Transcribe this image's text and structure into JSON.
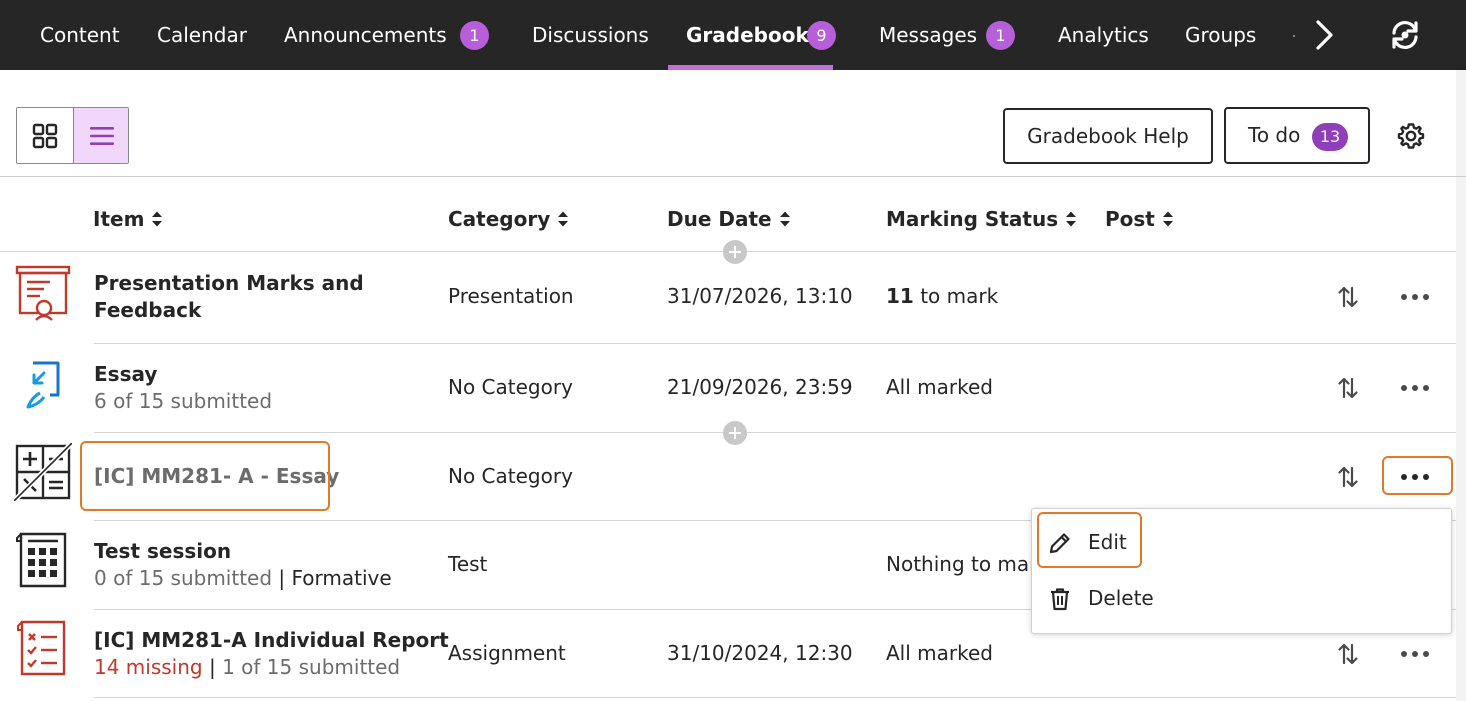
{
  "nav": {
    "items": [
      {
        "label": "Content"
      },
      {
        "label": "Calendar"
      },
      {
        "label": "Announcements",
        "badge": "1"
      },
      {
        "label": "Discussions"
      },
      {
        "label": "Gradebook",
        "badge": "9",
        "active": true
      },
      {
        "label": "Messages",
        "badge": "1"
      },
      {
        "label": "Analytics"
      },
      {
        "label": "Groups"
      }
    ],
    "more_icon": "chevron-right-icon",
    "sync_icon": "sync-icon"
  },
  "toolbar": {
    "view_grid_icon": "grid-view-icon",
    "view_list_icon": "list-view-icon",
    "help_label": "Gradebook Help",
    "todo_label": "To do",
    "todo_count": "13",
    "settings_icon": "gear-icon"
  },
  "table": {
    "headers": {
      "item": "Item",
      "category": "Category",
      "due": "Due Date",
      "status": "Marking Status",
      "post": "Post"
    },
    "rows": [
      {
        "icon": "presentation-icon",
        "title": "Presentation Marks and Feedback",
        "category": "Presentation",
        "due": "31/07/2026, 13:10",
        "status_count": "11",
        "status_text": "to mark"
      },
      {
        "icon": "essay-assignment-icon",
        "title": "Essay",
        "sub": "6 of 15 submitted",
        "category": "No Category",
        "due": "21/09/2026, 23:59",
        "status_text": "All marked"
      },
      {
        "icon": "calculation-icon",
        "title": "[IC] MM281- A - Essay",
        "category": "No Category"
      },
      {
        "icon": "test-icon",
        "title": "Test session",
        "sub_a": "0 of 15 submitted",
        "sub_sep": "|",
        "sub_b": "Formative",
        "category": "Test",
        "status_text": "Nothing to mar"
      },
      {
        "icon": "checklist-icon",
        "title": "[IC] MM281-A Individual Report",
        "sub_missing": "14 missing",
        "sub_sep": "|",
        "sub_b": "1 of 15 submitted",
        "category": "Assignment",
        "due": "31/10/2024, 12:30",
        "status_text": "All marked"
      }
    ]
  },
  "menu": {
    "edit_label": "Edit",
    "delete_label": "Delete"
  },
  "colors": {
    "nav_bg": "#262626",
    "accent": "#b65fd8",
    "highlight": "#e07a28",
    "missing": "#c0392b"
  }
}
